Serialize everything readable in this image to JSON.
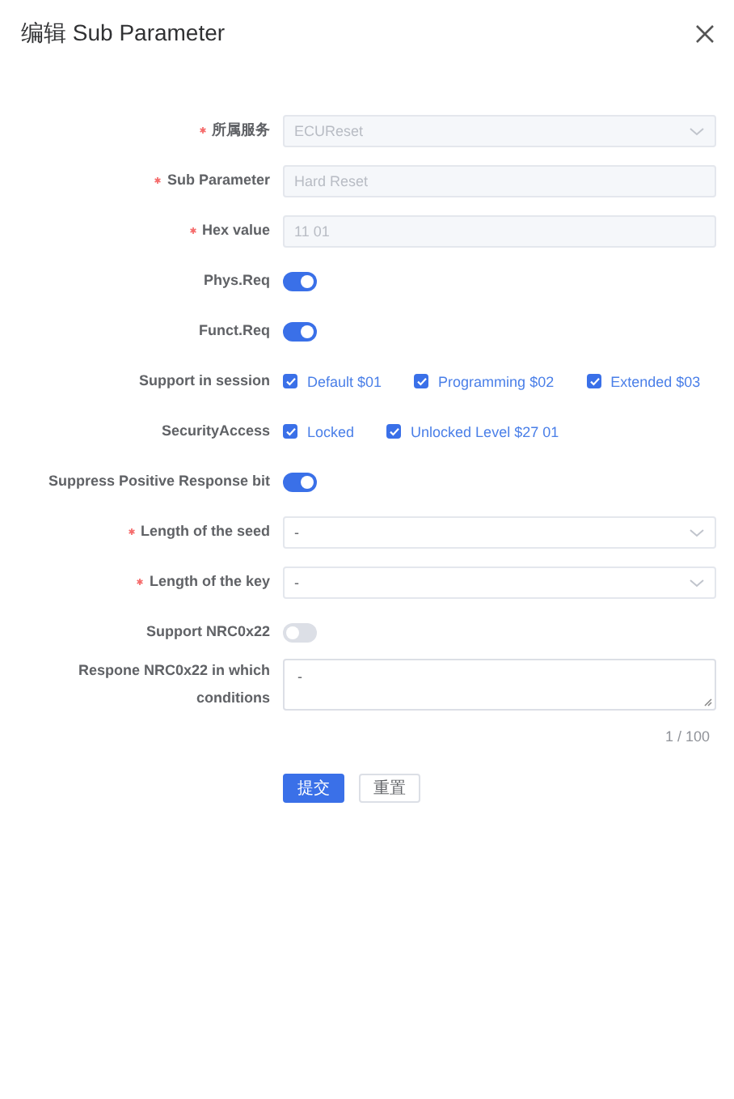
{
  "dialog": {
    "title": "编辑 Sub Parameter"
  },
  "fields": [
    {
      "kind": "select",
      "label": "所属服务",
      "required": true,
      "disabled": true,
      "value": "ECUReset"
    },
    {
      "kind": "input",
      "label": "Sub Parameter",
      "required": true,
      "disabled": true,
      "value": "Hard Reset"
    },
    {
      "kind": "input",
      "label": "Hex value",
      "required": true,
      "disabled": true,
      "value": "11 01"
    },
    {
      "kind": "switch",
      "label": "Phys.Req",
      "required": false,
      "on": true
    },
    {
      "kind": "switch",
      "label": "Funct.Req",
      "required": false,
      "on": true
    },
    {
      "kind": "checks",
      "label": "Support in session",
      "required": false,
      "options": [
        {
          "label": "Default $01",
          "checked": true
        },
        {
          "label": "Programming $02",
          "checked": true
        },
        {
          "label": "Extended $03",
          "checked": true
        }
      ]
    },
    {
      "kind": "checks",
      "label": "SecurityAccess",
      "required": false,
      "options": [
        {
          "label": "Locked",
          "checked": true
        },
        {
          "label": "Unlocked Level $27 01",
          "checked": true
        }
      ]
    },
    {
      "kind": "switch",
      "label": "Suppress Positive Response bit",
      "required": false,
      "on": true
    },
    {
      "kind": "select",
      "label": "Length of the seed",
      "required": true,
      "disabled": false,
      "value": "-"
    },
    {
      "kind": "select",
      "label": "Length of the key",
      "required": true,
      "disabled": false,
      "value": "-"
    },
    {
      "kind": "switch",
      "label": "Support NRC0x22",
      "required": false,
      "on": false
    },
    {
      "kind": "textarea",
      "label": "Respone NRC0x22 in which conditions",
      "required": false,
      "value": "-",
      "counter": "1 / 100"
    }
  ],
  "buttons": [
    {
      "label": "提交",
      "primary": true
    },
    {
      "label": "重置",
      "primary": false
    }
  ]
}
